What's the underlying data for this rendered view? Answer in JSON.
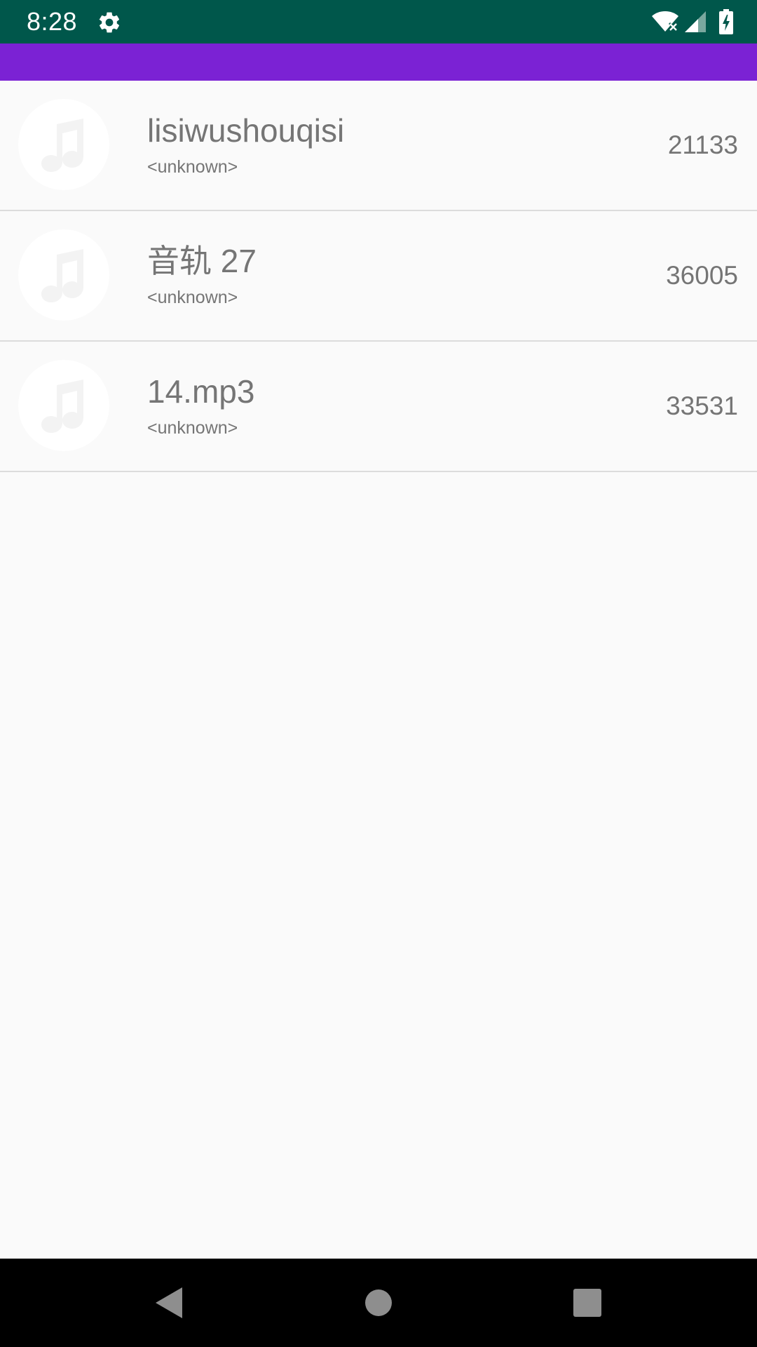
{
  "status_bar": {
    "time": "8:28",
    "icons": [
      "gear-icon",
      "wifi-off-icon",
      "cellular-signal-icon",
      "battery-charging-icon"
    ],
    "background": "#00574b"
  },
  "app_bar": {
    "color": "#7b22d4"
  },
  "tracks": [
    {
      "title": "lisiwushouqisi",
      "artist": "<unknown>",
      "count": "21133",
      "icon": "music-note-icon"
    },
    {
      "title": "音轨 27",
      "artist": "<unknown>",
      "count": "36005",
      "icon": "music-note-icon"
    },
    {
      "title": "14.mp3",
      "artist": "<unknown>",
      "count": "33531",
      "icon": "music-note-icon"
    }
  ],
  "nav_bar": {
    "buttons": [
      "back-icon",
      "home-icon",
      "recents-icon"
    ]
  }
}
